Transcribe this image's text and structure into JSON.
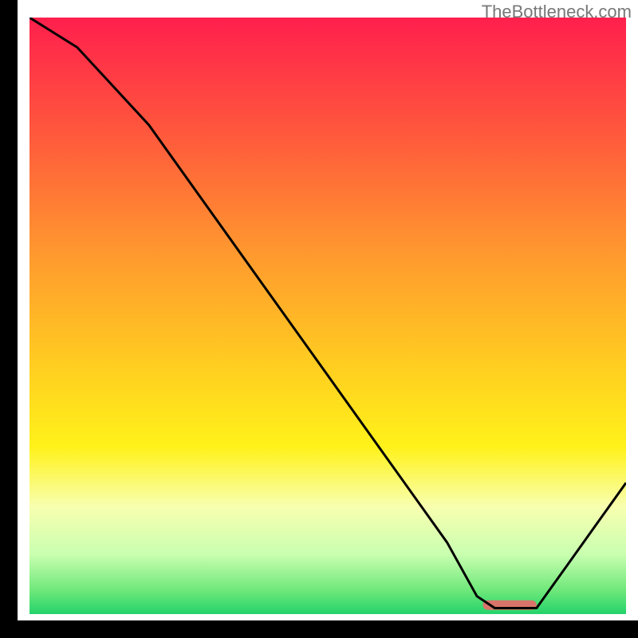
{
  "watermark": "TheBottleneck.com",
  "chart_data": {
    "type": "line",
    "title": "",
    "xlabel": "",
    "ylabel": "",
    "xlim": [
      0,
      100
    ],
    "ylim": [
      0,
      100
    ],
    "marker_band": {
      "x0": 76,
      "x1": 85,
      "y": 1.5,
      "color": "#d9746b"
    },
    "series": [
      {
        "name": "curve",
        "color": "#000000",
        "x": [
          0,
          8,
          20,
          30,
          40,
          50,
          60,
          70,
          75,
          78,
          85,
          90,
          95,
          100
        ],
        "y": [
          100,
          95,
          82,
          68,
          54,
          40,
          26,
          12,
          3,
          1,
          1,
          8,
          15,
          22
        ]
      }
    ],
    "gradient_stops": [
      {
        "offset": 0.0,
        "color": "#ff1f4d"
      },
      {
        "offset": 0.2,
        "color": "#ff5a3c"
      },
      {
        "offset": 0.4,
        "color": "#ff9a2e"
      },
      {
        "offset": 0.6,
        "color": "#ffd21f"
      },
      {
        "offset": 0.72,
        "color": "#fff21a"
      },
      {
        "offset": 0.82,
        "color": "#f8ffb0"
      },
      {
        "offset": 0.9,
        "color": "#c9ffb0"
      },
      {
        "offset": 0.96,
        "color": "#6fe87a"
      },
      {
        "offset": 1.0,
        "color": "#23d36b"
      }
    ]
  }
}
